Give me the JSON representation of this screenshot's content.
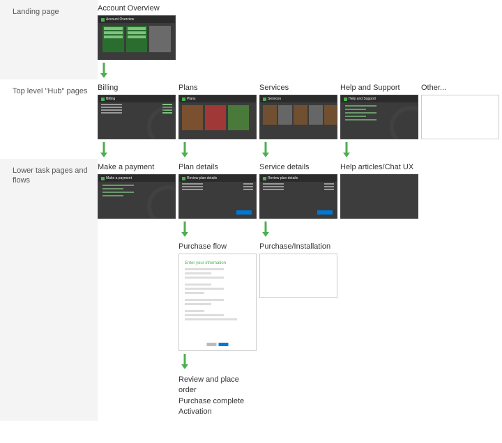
{
  "rows": {
    "landing": {
      "label": "Landing page"
    },
    "hub": {
      "label": "Top level \"Hub\" pages"
    },
    "task": {
      "label": "Lower task pages and flows"
    }
  },
  "landing": {
    "account_overview": "Account Overview",
    "thumb_title": "Account Overview"
  },
  "hub": {
    "billing": "Billing",
    "plans": "Plans",
    "services": "Services",
    "help": "Help and Support",
    "other": "Other..."
  },
  "task1": {
    "payment": "Make a payment",
    "plan_details": "Plan details",
    "service_details": "Service details",
    "help_articles": "Help articles/Chat UX"
  },
  "task2": {
    "purchase_flow": "Purchase flow",
    "purchase_install": "Purchase/Installation",
    "form_header": "Enter your information"
  },
  "task3": {
    "lines": "Review and place order\nPurchase complete\nActivation"
  },
  "thumb_labels": {
    "billing": "Billing",
    "plans": "Plans",
    "services": "Services",
    "help": "Help and Support",
    "payment": "Make a payment",
    "review": "Review plan details"
  },
  "colors": {
    "arrow": "#4CAF50"
  }
}
